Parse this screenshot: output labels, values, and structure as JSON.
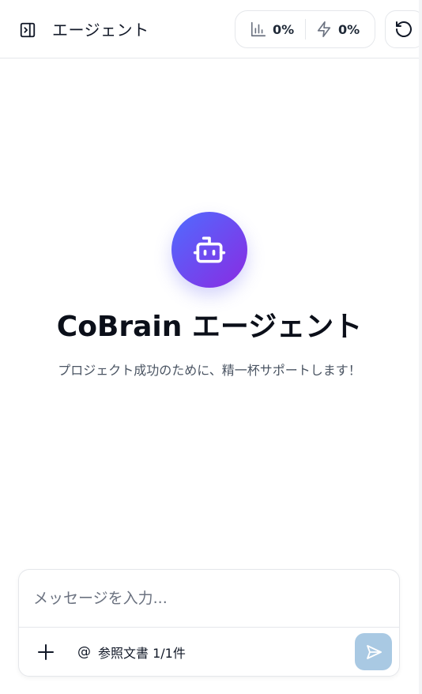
{
  "header": {
    "title": "エージェント",
    "usage_value": "0%",
    "credits_value": "0%"
  },
  "hero": {
    "title": "CoBrain エージェント",
    "subtitle": "プロジェクト成功のために、精一杯サポートします！"
  },
  "composer": {
    "placeholder": "メッセージを入力...",
    "value": "",
    "reference_prefix": "@",
    "reference_label": "参照文書 1/1件"
  },
  "colors": {
    "accent_gradient_start": "#4f6cff",
    "accent_gradient_end": "#8a2be2",
    "send_button": "#a9c9e3"
  },
  "icons": {
    "panel_toggle": "sidebar-toggle-icon",
    "usage": "bar-chart-icon",
    "credits": "lightning-icon",
    "reset": "refresh-icon",
    "avatar": "robot-icon",
    "add": "plus-icon",
    "send": "send-icon"
  }
}
